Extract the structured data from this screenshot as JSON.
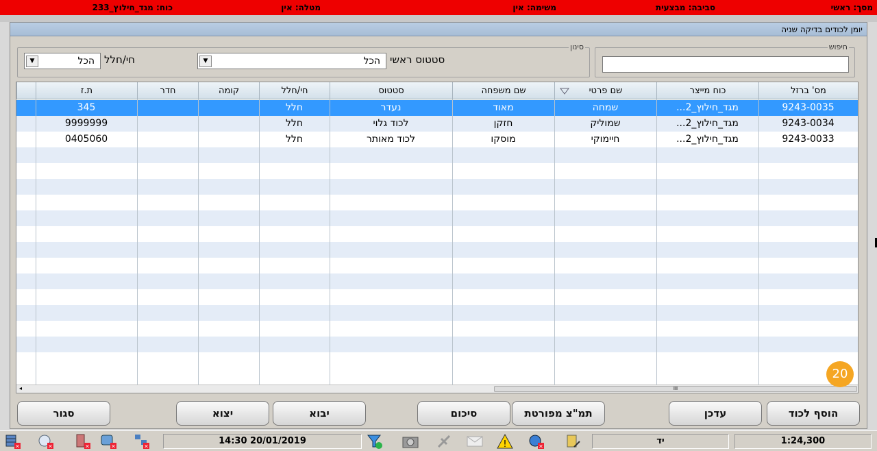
{
  "status_bar": {
    "screen": "מסך: ראשי",
    "environment": "סביבה: מבצעית",
    "mission": "משימה: אין",
    "task": "מטלה: אין",
    "force": "כוח: מגד_חילוץ_233"
  },
  "window": {
    "title": "יומן לכודים בדיקה שניה"
  },
  "search": {
    "group_label": "חיפוש",
    "value": ""
  },
  "filter": {
    "group_label": "סינון",
    "main_status_label": "סטטוס ראשי",
    "main_status_value": "הכל",
    "alive_dead_label": "חי/חלל",
    "alive_dead_value": "הכל"
  },
  "grid": {
    "columns": [
      "מס' ברזל",
      "כוח מייצר",
      "שם פרטי",
      "שם משפחה",
      "סטטוס",
      "חי/חלל",
      "קומה",
      "חדר",
      "ת.ז"
    ],
    "rows": [
      [
        "9243-0035",
        "מגד_חילוץ_2...",
        "שמחה",
        "מאוד",
        "נעדר",
        "חלל",
        "",
        "",
        "345"
      ],
      [
        "9243-0034",
        "מגד_חילוץ_2...",
        "שמוליק",
        "חזקן",
        "לכוד גלוי",
        "חלל",
        "",
        "",
        "9999999"
      ],
      [
        "9243-0033",
        "מגד_חילוץ_2...",
        "חיימוקי",
        "מוסקו",
        "לכוד מאותר",
        "חלל",
        "",
        "",
        "0405060"
      ]
    ],
    "selected_row": 0,
    "sort_column_index": 2,
    "scroll_thumb": "III"
  },
  "buttons": {
    "add_trapped": "הוסף לכוד",
    "update": "עדכן",
    "detailed_picture": "תמ\"צ מפורטת",
    "summary": "סיכום",
    "import": "יבוא",
    "export": "יצוא",
    "close": "סגור"
  },
  "badge": "20",
  "taskbar": {
    "datetime": "20/01/2019 14:30",
    "mode": "יד",
    "scale": "1:24,300"
  },
  "colors": {
    "status_bar": "#ee0000",
    "selection": "#3399ff",
    "alt_row": "#e4ecf7",
    "badge": "#f5a623"
  }
}
